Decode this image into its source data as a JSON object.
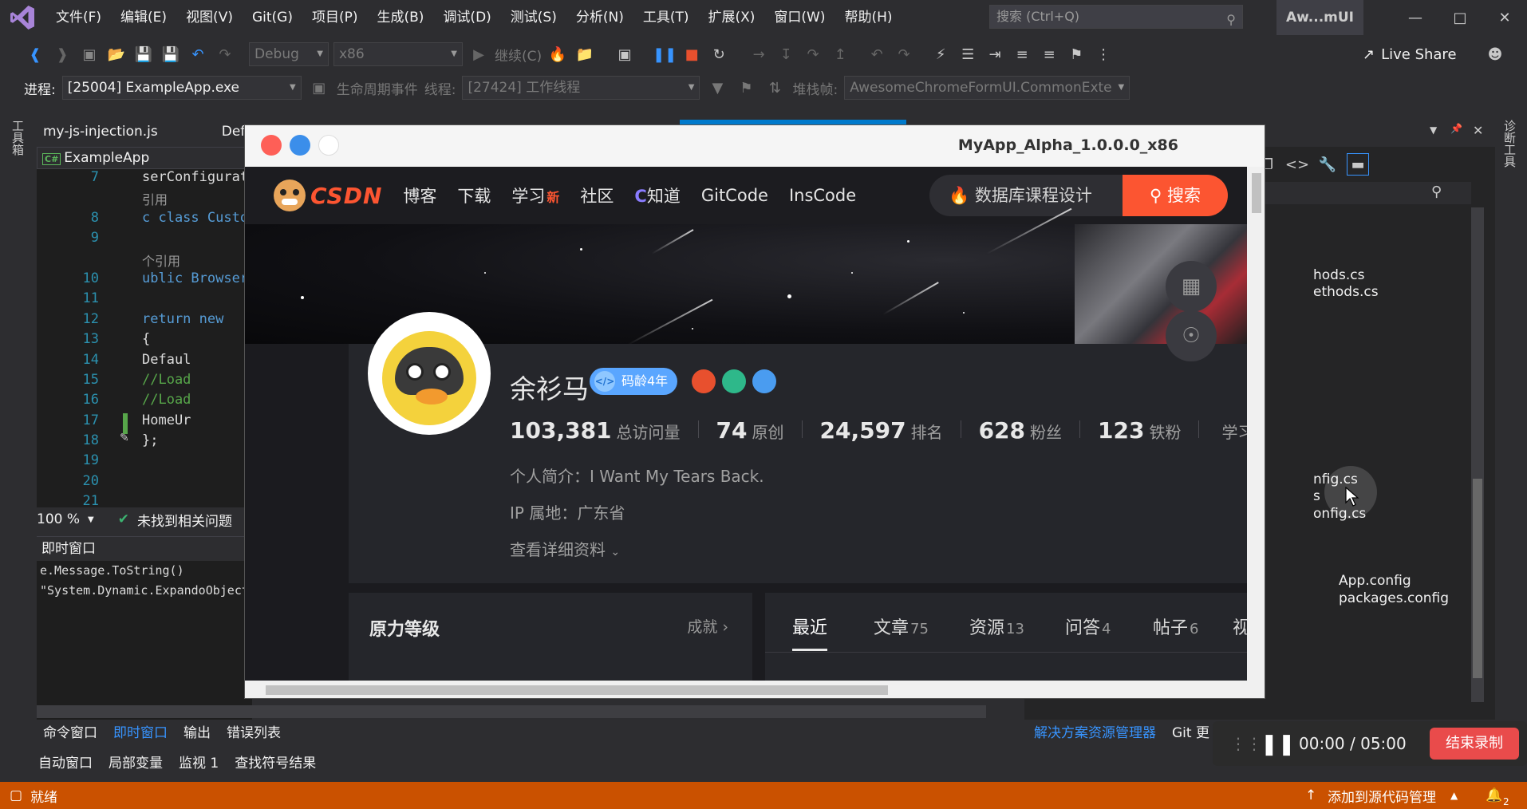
{
  "menubar": {
    "items": [
      "文件(F)",
      "编辑(E)",
      "视图(V)",
      "Git(G)",
      "项目(P)",
      "生成(B)",
      "调试(D)",
      "测试(S)",
      "分析(N)",
      "工具(T)",
      "扩展(X)",
      "窗口(W)",
      "帮助(H)"
    ],
    "search_placeholder": "搜索 (Ctrl+Q)",
    "solution_short": "Aw...mUI"
  },
  "toolbar": {
    "config": "Debug",
    "platform": "x86",
    "continue_label": "继续(C)",
    "live_share": "Live Share"
  },
  "debug_bar": {
    "process_label": "进程:",
    "process_value": "[25004] ExampleApp.exe",
    "lifecycle_label": "生命周期事件",
    "thread_label": "线程:",
    "thread_value": "[27424] 工作线程",
    "stackframe_label": "堆栈帧:",
    "stackframe_value": "AwesomeChromeFormUI.CommonExte"
  },
  "side_labels": {
    "toolbox": "工具箱",
    "diagnostics": "诊断工具"
  },
  "editor": {
    "tabs": [
      "my-js-injection.js",
      "Def"
    ],
    "nav_project": "ExampleApp",
    "lines": [
      {
        "n": "7",
        "text": "serConfigurat"
      },
      {
        "n": "",
        "text": "引用"
      },
      {
        "n": "8",
        "text": "c class Custo"
      },
      {
        "n": "9",
        "text": ""
      },
      {
        "n": "",
        "text": " 个引用"
      },
      {
        "n": "10",
        "text": "ublic Browser"
      },
      {
        "n": "11",
        "text": ""
      },
      {
        "n": "12",
        "text": "  return new"
      },
      {
        "n": "13",
        "text": "  {"
      },
      {
        "n": "14",
        "text": "     Defaul"
      },
      {
        "n": "15",
        "text": "     //Load"
      },
      {
        "n": "16",
        "text": "     //Load"
      },
      {
        "n": "17",
        "text": "     HomeUr"
      },
      {
        "n": "18",
        "text": "  };"
      },
      {
        "n": "19",
        "text": ""
      },
      {
        "n": "20",
        "text": ""
      },
      {
        "n": "21",
        "text": ""
      }
    ],
    "zoom": "100 %",
    "issues": "未找到相关问题"
  },
  "immediate": {
    "title": "即时窗口",
    "lines": [
      "e.Message.ToString()",
      "\"System.Dynamic.ExpandoObject"
    ]
  },
  "bottom_tabs_1": [
    "命令窗口",
    "即时窗口",
    "输出",
    "错误列表"
  ],
  "bottom_tabs_2": [
    "自动窗口",
    "局部变量",
    "监视 1",
    "查找符号结果"
  ],
  "solution_explorer": {
    "items": [
      "hods.cs",
      "ethods.cs",
      "nfig.cs",
      "s",
      "onfig.cs",
      "App.config",
      "packages.config"
    ],
    "tabs": [
      "解决方案资源管理器",
      "Git 更"
    ]
  },
  "statusbar": {
    "ready": "就绪",
    "source_control": "添加到源代码管理",
    "notifications": "2"
  },
  "recorder": {
    "time": "00:00 / 05:00",
    "stop_label": "结束录制"
  },
  "app": {
    "title": "MyApp_Alpha_1.0.0.0_x86",
    "nav": {
      "logo_text": "CSDN",
      "links": [
        "博客",
        "下载",
        "学习",
        "社区",
        "知道",
        "GitCode",
        "InsCode"
      ],
      "new_tag": "新",
      "search_query": "数据库课程设计",
      "search_button": "搜索"
    },
    "profile": {
      "name": "余衫马",
      "code_age": "码龄4年",
      "stats": [
        {
          "num": "103,381",
          "label": "总访问量"
        },
        {
          "num": "74",
          "label": "原创"
        },
        {
          "num": "24,597",
          "label": "排名"
        },
        {
          "num": "628",
          "label": "粉丝"
        },
        {
          "num": "123",
          "label": "铁粉"
        },
        {
          "num": "",
          "label": "学习成"
        }
      ],
      "bio": "个人简介：I Want My Tears Back.",
      "ip": "IP 属地：广东省",
      "detail_link": "查看详细资料"
    },
    "level_card": {
      "title": "原力等级",
      "more": "成就"
    },
    "content_tabs": [
      {
        "label": "最近",
        "count": ""
      },
      {
        "label": "文章",
        "count": "75"
      },
      {
        "label": "资源",
        "count": "13"
      },
      {
        "label": "问答",
        "count": "4"
      },
      {
        "label": "帖子",
        "count": "6"
      },
      {
        "label": "视",
        "count": ""
      }
    ]
  }
}
